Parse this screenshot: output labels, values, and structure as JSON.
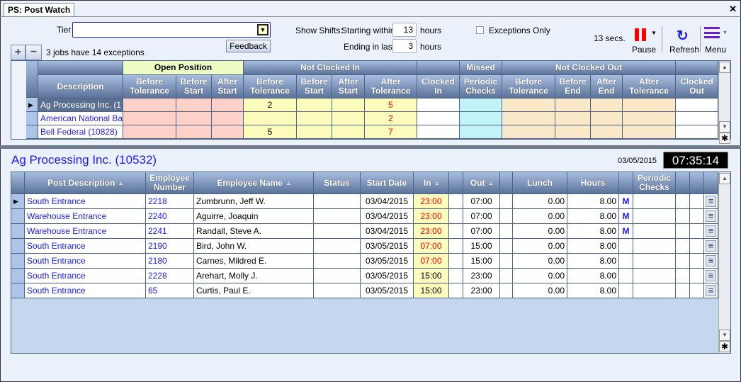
{
  "tab": {
    "title": "PS: Post Watch",
    "close": "✕"
  },
  "filters": {
    "tier_label": "Tier",
    "tier_value": "",
    "feedback": "Feedback",
    "show_shifts": "Show Shifts:",
    "starting_within": "Starting within",
    "starting_value": "13",
    "ending_in_last": "Ending in last",
    "ending_value": "3",
    "hours": "hours",
    "exceptions_only": "Exceptions Only",
    "exceptions_checked": false
  },
  "toolbar": {
    "timer": "13 secs.",
    "pause": "Pause",
    "refresh": "Refresh",
    "menu": "Menu",
    "pause_color": "#ff0000",
    "refresh_color": "#2020e0",
    "menu_color": "#6a1fcf"
  },
  "summary": {
    "expand": "+",
    "collapse": "−",
    "text": "3 jobs have 14 exceptions"
  },
  "top_grid": {
    "groups": [
      {
        "label": "",
        "span": "desc"
      },
      {
        "label": "Open Position"
      },
      {
        "label": "Not Clocked In"
      },
      {
        "label": ""
      },
      {
        "label": "Missed"
      },
      {
        "label": "Not Clocked Out"
      },
      {
        "label": ""
      }
    ],
    "headers": [
      "Description",
      "Before Tolerance",
      "Before Start",
      "After Start",
      "Before Tolerance",
      "Before Start",
      "After Start",
      "After Tolerance",
      "Clocked In",
      "Periodic Checks",
      "Before Tolerance",
      "Before End",
      "After End",
      "After Tolerance",
      "Clocked Out"
    ],
    "rows": [
      {
        "desc": "Ag Processing Inc. (1",
        "vals": [
          "",
          "",
          "",
          "2",
          "",
          "",
          "5",
          "",
          "",
          "",
          "",
          "",
          "",
          ""
        ]
      },
      {
        "desc": "American National Ba",
        "vals": [
          "",
          "",
          "",
          "",
          "",
          "",
          "2",
          "",
          "",
          "",
          "",
          "",
          "",
          ""
        ]
      },
      {
        "desc": "Bell Federal (10828)",
        "vals": [
          "",
          "",
          "",
          "5",
          "",
          "",
          "7",
          "",
          "",
          "",
          "",
          "",
          "",
          ""
        ]
      }
    ],
    "colors": {
      "open": "#fdd0c8",
      "notin": "#fbfbbb",
      "missed": "#c2f3f8",
      "notout": "#fae9c8",
      "header_open": "#eefcc4"
    }
  },
  "detail": {
    "title": "Ag Processing Inc. (10532)",
    "date": "03/05/2015",
    "clock": "07:35:14"
  },
  "bottom_grid": {
    "headers": [
      "Post Description",
      "Employee Number",
      "Employee Name",
      "Status",
      "Start Date",
      "In",
      "",
      "Out",
      "",
      "Lunch",
      "Hours",
      "",
      "Periodic Checks",
      "",
      "",
      ""
    ],
    "rows": [
      [
        "South Entrance",
        "2218",
        "Zumbrunn, Jeff W.",
        "",
        "03/04/2015",
        "23:00",
        "",
        "07:00",
        "",
        "0.00",
        "8.00",
        "M"
      ],
      [
        "Warehouse Entrance",
        "2240",
        "Aguirre, Joaquin",
        "",
        "03/04/2015",
        "23:00",
        "",
        "07:00",
        "",
        "0.00",
        "8.00",
        "M"
      ],
      [
        "Warehouse Entrance",
        "2241",
        "Randall, Steve A.",
        "",
        "03/04/2015",
        "23:00",
        "",
        "07:00",
        "",
        "0.00",
        "8.00",
        "M"
      ],
      [
        "South Entrance",
        "2190",
        "Bird, John W.",
        "",
        "03/05/2015",
        "07:00",
        "",
        "15:00",
        "",
        "0.00",
        "8.00",
        ""
      ],
      [
        "South Entrance",
        "2180",
        "Carnes, Mildred E.",
        "",
        "03/05/2015",
        "07:00",
        "",
        "15:00",
        "",
        "0.00",
        "8.00",
        ""
      ],
      [
        "South Entrance",
        "2228",
        "Arehart, Molly J.",
        "",
        "03/05/2015",
        "15:00",
        "",
        "23:00",
        "",
        "0.00",
        "8.00",
        ""
      ],
      [
        "South Entrance",
        "65",
        "Curtis, Paul E.",
        "",
        "03/05/2015",
        "15:00",
        "",
        "23:00",
        "",
        "0.00",
        "8.00",
        ""
      ]
    ],
    "late_in_rows": [
      0,
      1,
      2,
      3,
      4
    ]
  }
}
